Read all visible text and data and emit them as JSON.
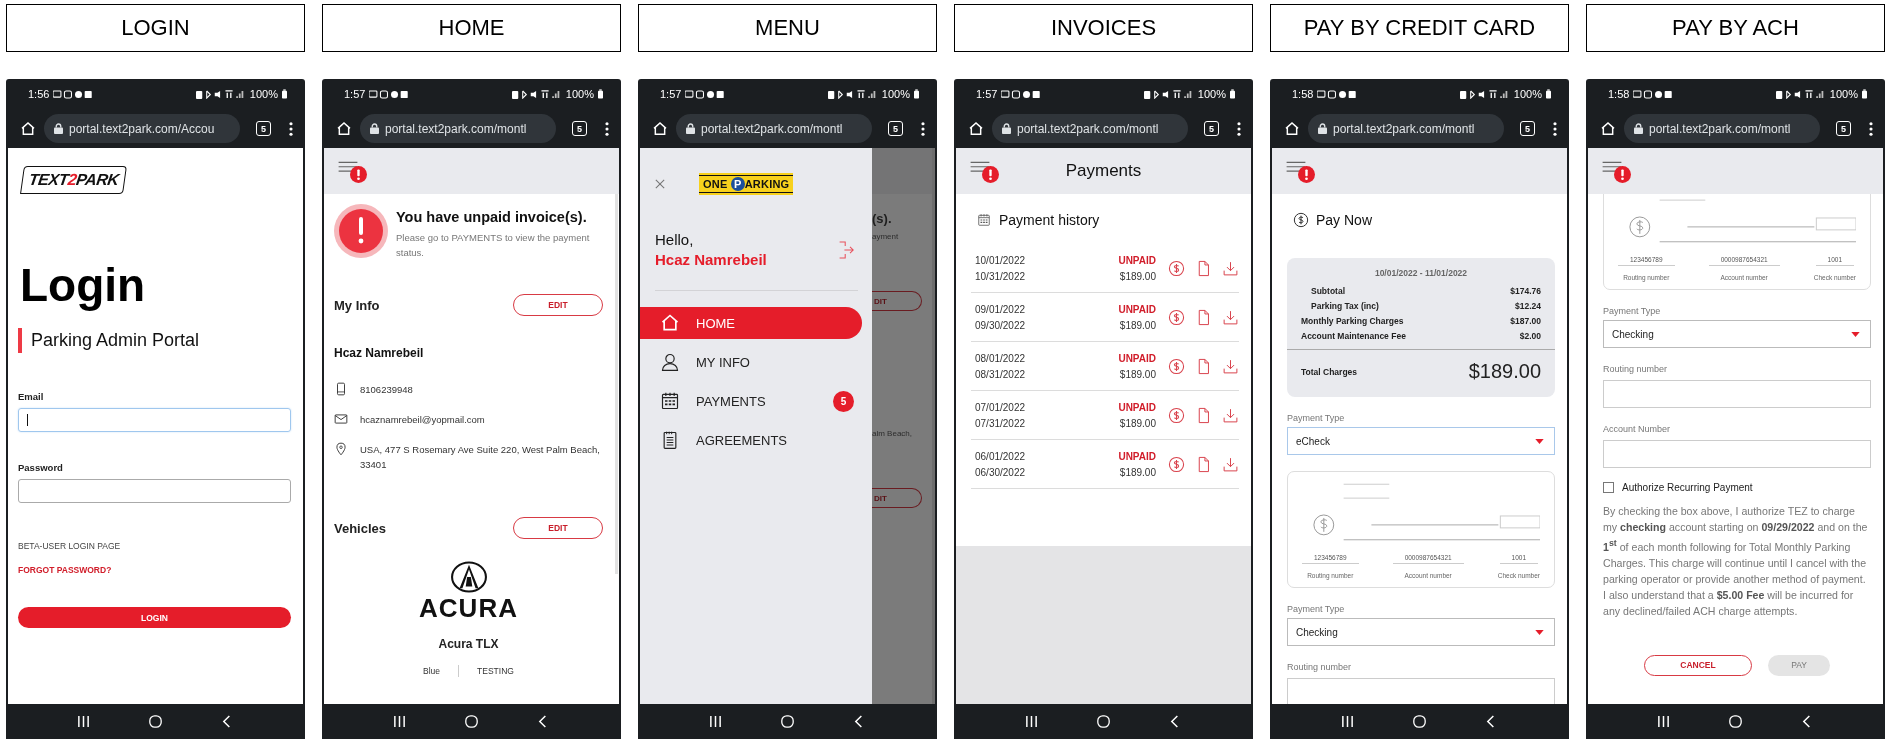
{
  "screens": [
    {
      "kind": "login",
      "caption": "LOGIN",
      "time": "1:56",
      "battery": "100%",
      "url": "portal.text2park.com/Accou",
      "tab_count": "5",
      "logo": {
        "before": "TEXT",
        "accent": "2",
        "after": "PARK"
      },
      "title": "Login",
      "subtitle": "Parking Admin Portal",
      "fields": [
        {
          "label": "Email",
          "focused": true
        },
        {
          "label": "Password",
          "focused": false
        }
      ],
      "links": [
        {
          "text": "BETA-USER LOGIN PAGE",
          "kind": "plain"
        },
        {
          "text": "FORGOT PASSWORD?",
          "kind": "accent"
        }
      ],
      "button": "LOGIN"
    },
    {
      "kind": "home",
      "caption": "HOME",
      "time": "1:57",
      "battery": "100%",
      "url": "portal.text2park.com/montl",
      "tab_count": "5",
      "alert": {
        "title": "You have unpaid invoice(s).",
        "text": "Please go to PAYMENTS to view the payment status."
      },
      "info": {
        "heading": "My Info",
        "edit": "EDIT",
        "name": "Hcaz Namrebeil",
        "rows": [
          {
            "kind": "phone",
            "text": "8106239948"
          },
          {
            "kind": "email",
            "text": "hcaznamrebeil@yopmail.com"
          },
          {
            "kind": "location",
            "text": "USA, 477 S Rosemary Ave Suite 220, West Palm Beach, 33401"
          }
        ]
      },
      "vehicles": {
        "heading": "Vehicles",
        "edit": "EDIT",
        "brand": "ACURA",
        "model": "Acura TLX",
        "paint": "Blue",
        "plate": "TESTING"
      }
    },
    {
      "kind": "menu",
      "caption": "MENU",
      "time": "1:57",
      "battery": "100%",
      "url": "portal.text2park.com/montl",
      "tab_count": "5",
      "logo": {
        "before": "ONE",
        "accent": "P",
        "after": "ARKING"
      },
      "greeting": "Hello,",
      "name": "Hcaz Namrebeil",
      "items": [
        {
          "kind": "home",
          "label": "HOME",
          "selected": true
        },
        {
          "kind": "user",
          "label": "MY INFO",
          "selected": false
        },
        {
          "kind": "calendar",
          "label": "PAYMENTS",
          "selected": false,
          "badge": "5"
        },
        {
          "kind": "document",
          "label": "AGREEMENTS",
          "selected": false
        }
      ],
      "backdrop": [
        {
          "kind": "heading",
          "text": "(s)."
        },
        {
          "kind": "note",
          "text": "ayment"
        },
        {
          "kind": "button",
          "text": "DIT"
        },
        {
          "kind": "note",
          "text": "alm Beach,"
        },
        {
          "kind": "button",
          "text": "DIT"
        }
      ]
    },
    {
      "kind": "invoices",
      "caption": "INVOICES",
      "time": "1:57",
      "battery": "100%",
      "url": "portal.text2park.com/montl",
      "tab_count": "5",
      "title": "Payments",
      "section": "Payment history",
      "rows": [
        {
          "start": "10/01/2022",
          "end": "10/31/2022",
          "status": "UNPAID",
          "amount": "$189.00"
        },
        {
          "start": "09/01/2022",
          "end": "09/30/2022",
          "status": "UNPAID",
          "amount": "$189.00"
        },
        {
          "start": "08/01/2022",
          "end": "08/31/2022",
          "status": "UNPAID",
          "amount": "$189.00"
        },
        {
          "start": "07/01/2022",
          "end": "07/31/2022",
          "status": "UNPAID",
          "amount": "$189.00"
        },
        {
          "start": "06/01/2022",
          "end": "06/30/2022",
          "status": "UNPAID",
          "amount": "$189.00"
        }
      ]
    },
    {
      "kind": "pay",
      "caption": "PAY BY CREDIT CARD",
      "time": "1:58",
      "battery": "100%",
      "url": "portal.text2park.com/montl",
      "tab_count": "5",
      "section": "Pay Now",
      "summary": {
        "period": "10/01/2022 - 11/01/2022",
        "lines": [
          {
            "label": "Subtotal",
            "value": "$174.76",
            "kind": "sub"
          },
          {
            "label": "Parking Tax (inc)",
            "value": "$12.24",
            "kind": "sub"
          },
          {
            "label": "Monthly Parking Charges",
            "value": "$187.00",
            "kind": "main"
          },
          {
            "label": "Account Maintenance Fee",
            "value": "$2.00",
            "kind": "main"
          }
        ],
        "total_label": "Total Charges",
        "total": "$189.00"
      },
      "form": [
        {
          "kind": "select",
          "label": "Payment Type",
          "value": "eCheck",
          "focused": true
        },
        {
          "kind": "check_sample",
          "partial": false,
          "numbers": [
            "123456789",
            "0000987654321",
            "1001"
          ],
          "labels": [
            "Routing number",
            "Account number",
            "Check number"
          ]
        },
        {
          "kind": "select",
          "label": "Payment Type",
          "value": "Checking",
          "focused": false
        },
        {
          "kind": "field",
          "label": "Routing number"
        }
      ]
    },
    {
      "kind": "pay",
      "caption": "PAY BY ACH",
      "time": "1:58",
      "battery": "100%",
      "url": "portal.text2park.com/montl",
      "tab_count": "5",
      "form": [
        {
          "kind": "check_sample",
          "partial": true,
          "numbers": [
            "123456789",
            "0000987654321",
            "1001"
          ],
          "labels": [
            "Routing number",
            "Account number",
            "Check number"
          ]
        },
        {
          "kind": "select",
          "label": "Payment Type",
          "value": "Checking",
          "focused": false
        },
        {
          "kind": "field",
          "label": "Routing number"
        },
        {
          "kind": "field",
          "label": "Account Number"
        },
        {
          "kind": "checkbox",
          "label": "Authorize Recurring Payment",
          "checked": false
        },
        {
          "kind": "paragraph",
          "text": "By checking the box above, I authorize TEZ to charge my **checking** account starting on **09/29/2022** and on the **1**$^{st}$ of each month following for Total Monthly Parking Charges. This charge will continue until I cancel with the parking operator or provide another method of payment. I also understand that a **$5.00 Fee** will be incurred for any declined/failed ACH charge attempts."
        },
        {
          "kind": "buttons",
          "buttons": [
            {
              "label": "CANCEL",
              "kind": "outline",
              "disabled": false
            },
            {
              "label": "PAY",
              "kind": "solid",
              "disabled": true
            }
          ]
        }
      ]
    }
  ]
}
